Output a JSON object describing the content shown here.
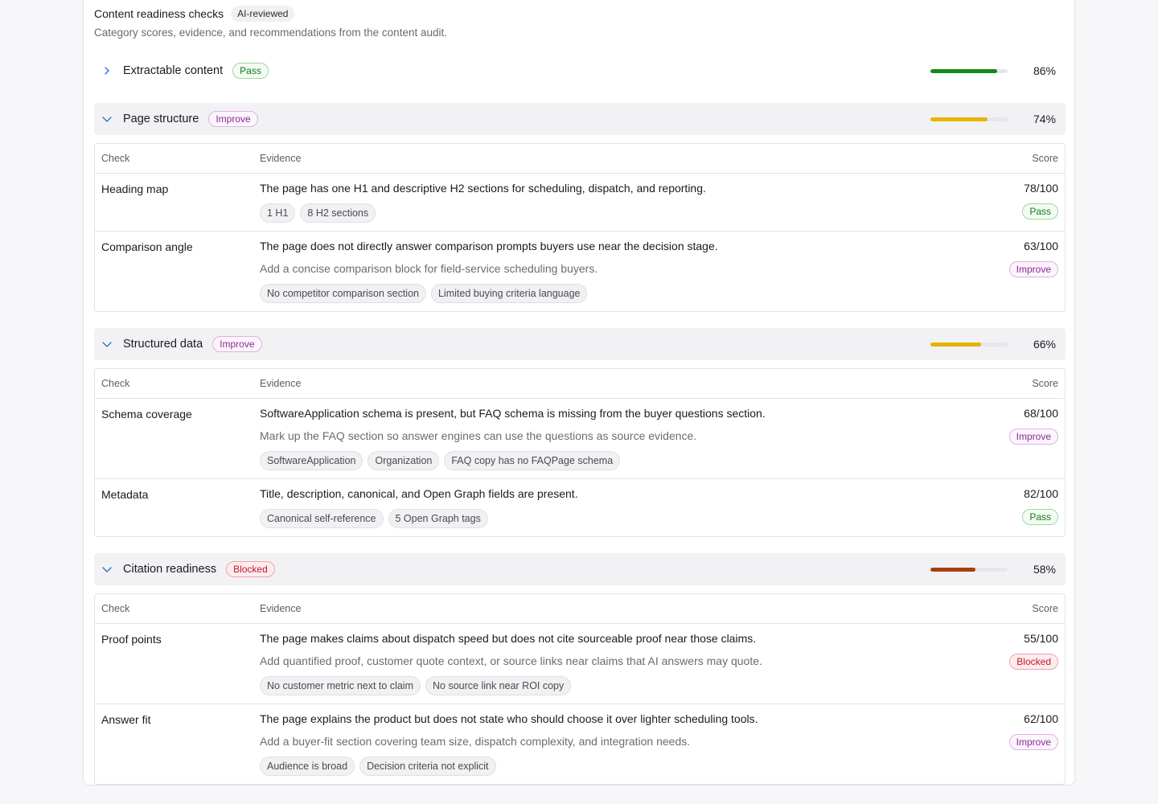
{
  "header": {
    "title": "Content readiness checks",
    "ai_badge": "AI-reviewed",
    "subtitle": "Category scores, evidence, and recommendations from the content audit."
  },
  "colors": {
    "pass_bar": "#138a1e",
    "improve_bar": "#e6b400",
    "blocked_bar": "#a8400c",
    "chevron": "#2f6fdb"
  },
  "table_headers": {
    "check": "Check",
    "evidence": "Evidence",
    "score": "Score"
  },
  "sections": [
    {
      "name": "Extractable content",
      "status": "Pass",
      "percent_label": "86%",
      "percent": 86,
      "expanded": false
    },
    {
      "name": "Page structure",
      "status": "Improve",
      "percent_label": "74%",
      "percent": 74,
      "expanded": true,
      "rows": [
        {
          "check": "Heading map",
          "evidence": "The page has one H1 and descriptive H2 sections for scheduling, dispatch, and reporting.",
          "recommendation": "",
          "tags": [
            "1 H1",
            "8 H2 sections"
          ],
          "score": "78/100",
          "status": "Pass"
        },
        {
          "check": "Comparison angle",
          "evidence": "The page does not directly answer comparison prompts buyers use near the decision stage.",
          "recommendation": "Add a concise comparison block for field-service scheduling buyers.",
          "tags": [
            "No competitor comparison section",
            "Limited buying criteria language"
          ],
          "score": "63/100",
          "status": "Improve"
        }
      ]
    },
    {
      "name": "Structured data",
      "status": "Improve",
      "percent_label": "66%",
      "percent": 66,
      "expanded": true,
      "rows": [
        {
          "check": "Schema coverage",
          "evidence": "SoftwareApplication schema is present, but FAQ schema is missing from the buyer questions section.",
          "recommendation": "Mark up the FAQ section so answer engines can use the questions as source evidence.",
          "tags": [
            "SoftwareApplication",
            "Organization",
            "FAQ copy has no FAQPage schema"
          ],
          "score": "68/100",
          "status": "Improve"
        },
        {
          "check": "Metadata",
          "evidence": "Title, description, canonical, and Open Graph fields are present.",
          "recommendation": "",
          "tags": [
            "Canonical self-reference",
            "5 Open Graph tags"
          ],
          "score": "82/100",
          "status": "Pass"
        }
      ]
    },
    {
      "name": "Citation readiness",
      "status": "Blocked",
      "percent_label": "58%",
      "percent": 58,
      "expanded": true,
      "rows": [
        {
          "check": "Proof points",
          "evidence": "The page makes claims about dispatch speed but does not cite sourceable proof near those claims.",
          "recommendation": "Add quantified proof, customer quote context, or source links near claims that AI answers may quote.",
          "tags": [
            "No customer metric next to claim",
            "No source link near ROI copy"
          ],
          "score": "55/100",
          "status": "Blocked"
        },
        {
          "check": "Answer fit",
          "evidence": "The page explains the product but does not state who should choose it over lighter scheduling tools.",
          "recommendation": "Add a buyer-fit section covering team size, dispatch complexity, and integration needs.",
          "tags": [
            "Audience is broad",
            "Decision criteria not explicit"
          ],
          "score": "62/100",
          "status": "Improve"
        }
      ]
    }
  ]
}
